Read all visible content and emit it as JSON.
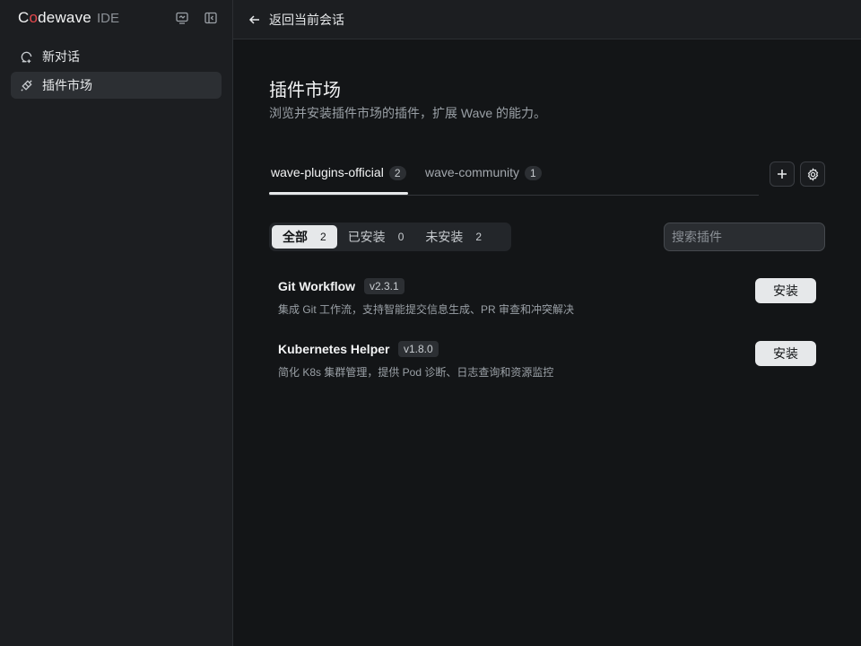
{
  "brand": {
    "logo_prefix": "C",
    "logo_o": "o",
    "logo_rest": "dewave",
    "tag": "IDE"
  },
  "sidebar": {
    "items": [
      {
        "label": "新对话",
        "icon": "new-chat-icon",
        "active": false
      },
      {
        "label": "插件市场",
        "icon": "plugin-icon",
        "active": true
      }
    ]
  },
  "topbar": {
    "back_label": "返回当前会话"
  },
  "page": {
    "title": "插件市场",
    "subtitle": "浏览并安装插件市场的插件，扩展 Wave 的能力。"
  },
  "tabs": [
    {
      "label": "wave-plugins-official",
      "count": "2",
      "active": true
    },
    {
      "label": "wave-community",
      "count": "1",
      "active": false
    }
  ],
  "filter": [
    {
      "label": "全部",
      "count": "2",
      "active": true
    },
    {
      "label": "已安装",
      "count": "0",
      "active": false
    },
    {
      "label": "未安装",
      "count": "2",
      "active": false
    }
  ],
  "search": {
    "placeholder": "搜索插件",
    "value": ""
  },
  "plugins": [
    {
      "name": "Git Workflow",
      "version": "v2.3.1",
      "description": "集成 Git 工作流，支持智能提交信息生成、PR 审查和冲突解决",
      "action": "安装"
    },
    {
      "name": "Kubernetes Helper",
      "version": "v1.8.0",
      "description": "简化 K8s 集群管理，提供 Pod 诊断、日志查询和资源监控",
      "action": "安装"
    }
  ],
  "colors": {
    "accent": "#e5484d",
    "active_bg": "#e6e8ea"
  }
}
